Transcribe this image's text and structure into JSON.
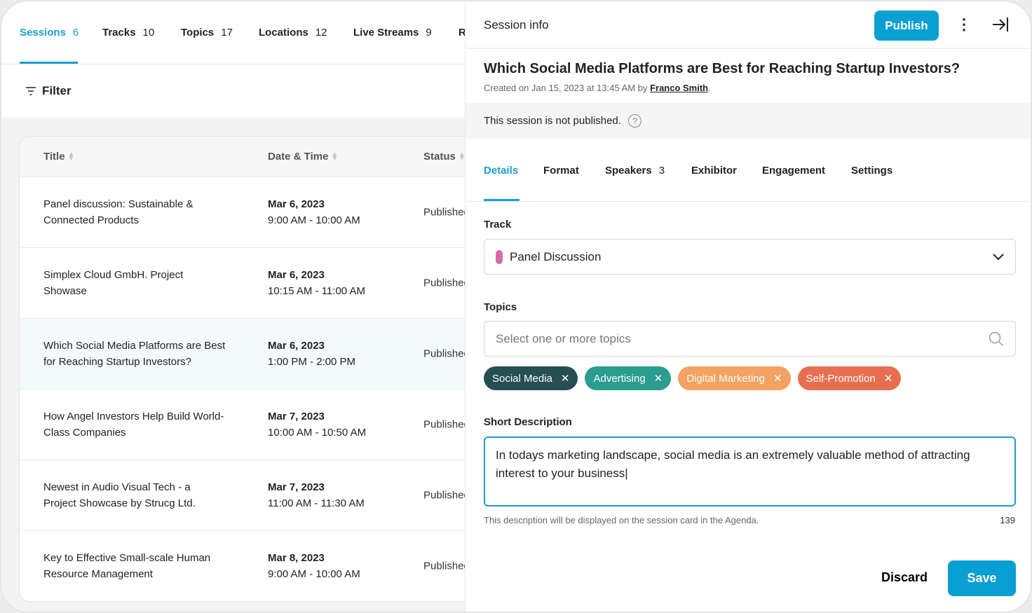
{
  "left": {
    "tabs": [
      {
        "label": "Sessions",
        "count": "6"
      },
      {
        "label": "Tracks",
        "count": "10"
      },
      {
        "label": "Topics",
        "count": "17"
      },
      {
        "label": "Locations",
        "count": "12"
      },
      {
        "label": "Live Streams",
        "count": "9"
      },
      {
        "label": "R",
        "count": ""
      }
    ],
    "filter_label": "Filter",
    "columns": [
      "Title",
      "Date & Time",
      "Status"
    ],
    "rows": [
      {
        "title": "Panel discussion: Sustainable & Connected Products",
        "date": "Mar 6, 2023",
        "time": "9:00 AM - 10:00 AM",
        "status": "Published"
      },
      {
        "title": "Simplex Cloud GmbH. Project Showase",
        "date": "Mar 6, 2023",
        "time": "10:15 AM - 11:00 AM",
        "status": "Published"
      },
      {
        "title": "Which Social Media Platforms are Best for Reaching Startup Investors?",
        "date": "Mar 6, 2023",
        "time": "1:00 PM - 2:00 PM",
        "status": "Published"
      },
      {
        "title": "How Angel Investors Help Build World-Class Companies",
        "date": "Mar 7, 2023",
        "time": "10:00 AM - 10:50 AM",
        "status": "Published"
      },
      {
        "title": "Newest in Audio Visual Tech - a Project Showcase by Strucg Ltd.",
        "date": "Mar 7, 2023",
        "time": "11:00 AM - 11:30 AM",
        "status": "Published"
      },
      {
        "title": "Key to Effective Small-scale Human Resource Management",
        "date": "Mar 8, 2023",
        "time": "9:00 AM - 10:00 AM",
        "status": "Published"
      }
    ]
  },
  "right": {
    "header_title": "Session info",
    "publish_label": "Publish",
    "session_title": "Which Social Media Platforms are Best for Reaching Startup Investors?",
    "created_prefix": "Created on Jan 15, 2023 at 13:45 AM by ",
    "created_by": "Franco Smith",
    "created_suffix": ".",
    "notice": "This session is not published.",
    "tabs": [
      {
        "label": "Details",
        "count": ""
      },
      {
        "label": "Format",
        "count": ""
      },
      {
        "label": "Speakers",
        "count": "3"
      },
      {
        "label": "Exhibitor",
        "count": ""
      },
      {
        "label": "Engagement",
        "count": ""
      },
      {
        "label": "Settings",
        "count": ""
      }
    ],
    "track_label": "Track",
    "track_value": "Panel Discussion",
    "track_color": "#d96aa6",
    "topics_label": "Topics",
    "topics_placeholder": "Select one or more topics",
    "chips": [
      {
        "label": "Social Media",
        "color": "#254f52"
      },
      {
        "label": "Advertising",
        "color": "#2a9d8f"
      },
      {
        "label": "Digital Marketing",
        "color": "#f4a261"
      },
      {
        "label": "Self-Promotion",
        "color": "#e76f51"
      }
    ],
    "desc_label": "Short Description",
    "desc_value": "In todays marketing landscape, social media is an extremely valuable method of attracting interest to your business",
    "desc_hint": "This description will be displayed on the session card in the Agenda.",
    "desc_count": "139",
    "discard_label": "Discard",
    "save_label": "Save"
  },
  "accent": "#1a9fd0"
}
